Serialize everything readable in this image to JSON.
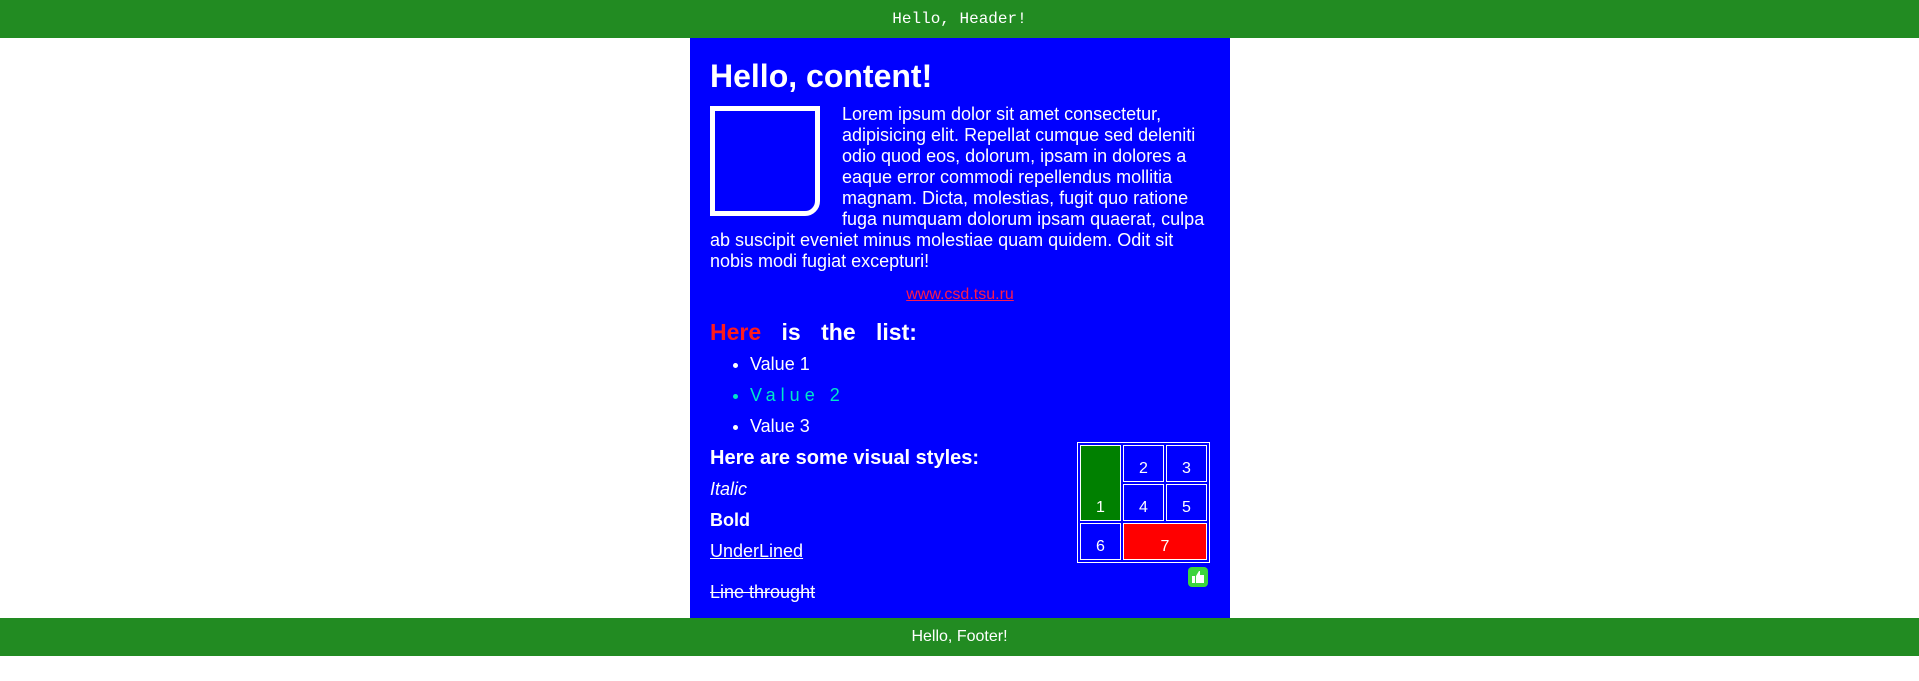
{
  "header": {
    "text": "Hello, Header!"
  },
  "content": {
    "title": "Hello, content!",
    "paragraph": "Lorem ipsum dolor sit amet consectetur, adipisicing elit. Repellat cumque sed deleniti odio quod eos, dolorum, ipsam in dolores a eaque error commodi repellendus mollitia magnam. Dicta, molestias, fugit quo ratione fuga numquam dolorum ipsam quaerat, culpa ab suscipit eveniet minus molestiae quam quidem. Odit sit nobis modi fugiat excepturi!",
    "link": "www.csd.tsu.ru",
    "list_title_highlight": "Here",
    "list_title_rest": "is the list:",
    "list_items": [
      "Value 1",
      "Value 2",
      "Value 3"
    ],
    "styles_title": "Here are some visual styles:",
    "styles": {
      "italic": "Italic",
      "bold": "Bold",
      "underlined": "UnderLined",
      "through": "Line throught"
    },
    "grid": {
      "cells": [
        "1",
        "2",
        "3",
        "4",
        "5",
        "6",
        "7"
      ]
    },
    "icon": "thumbs-up-icon"
  },
  "footer": {
    "text": "Hello, Footer!"
  },
  "colors": {
    "header_footer": "#228b22",
    "content_bg": "#0000ff",
    "accent_red": "#ff1a1a",
    "teal": "#00e6c8",
    "grid_green": "#008000",
    "grid_red": "#ff0000"
  }
}
